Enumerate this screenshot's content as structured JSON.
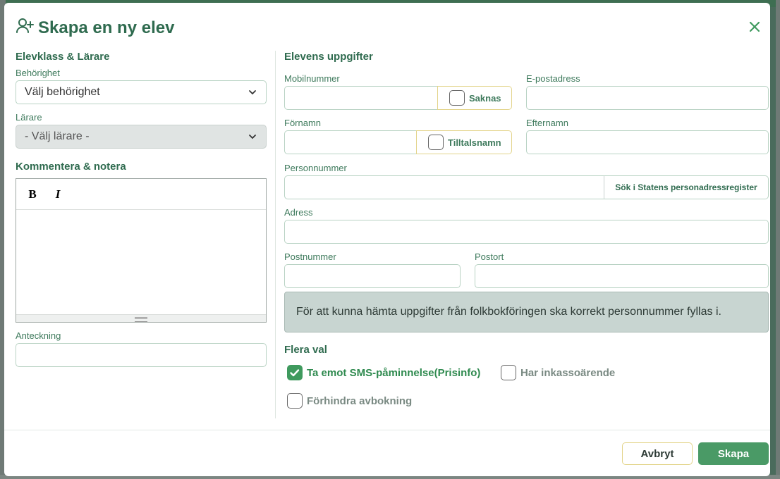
{
  "modal": {
    "title": "Skapa en ny elev",
    "title_icon": "user-plus-icon",
    "close_icon": "close-icon"
  },
  "left": {
    "section_title": "Elevklass & Lärare",
    "behorighet": {
      "label": "Behörighet",
      "value": "Välj behörighet"
    },
    "larare": {
      "label": "Lärare",
      "value": "- Välj lärare -"
    },
    "comment_title": "Kommentera & notera",
    "editor": {
      "bold_label": "B",
      "italic_label": "I",
      "content": ""
    },
    "anteckning": {
      "label": "Anteckning",
      "value": ""
    }
  },
  "right": {
    "section_title": "Elevens uppgifter",
    "mobil": {
      "label": "Mobilnummer",
      "value": "",
      "addon_label": "Saknas",
      "addon_checked": false
    },
    "epost": {
      "label": "E-postadress",
      "value": ""
    },
    "fornamn": {
      "label": "Förnamn",
      "value": "",
      "addon_label": "Tilltalsnamn",
      "addon_checked": false
    },
    "efternamn": {
      "label": "Efternamn",
      "value": ""
    },
    "personnummer": {
      "label": "Personnummer",
      "value": "",
      "button_label": "Sök i Statens personadressregister"
    },
    "adress": {
      "label": "Adress",
      "value": ""
    },
    "postnummer": {
      "label": "Postnummer",
      "value": ""
    },
    "postort": {
      "label": "Postort",
      "value": ""
    },
    "info_text": "För att kunna hämta uppgifter från folkbokföringen ska korrekt personnummer fyllas i.",
    "options_title": "Flera val",
    "options": [
      {
        "label": "Ta emot SMS-påminnelse(Prisinfo)",
        "checked": true
      },
      {
        "label": "Har inkassoärende",
        "checked": false
      },
      {
        "label": "Förhindra avbokning",
        "checked": false
      }
    ]
  },
  "footer": {
    "cancel_label": "Avbryt",
    "create_label": "Skapa"
  },
  "colors": {
    "accent": "#2f6b4f",
    "primary_button": "#4a9a66",
    "checkbox_checked": "#3f9a5e",
    "info_bg": "#c8d5d1",
    "warning_border": "#e3d48a"
  }
}
